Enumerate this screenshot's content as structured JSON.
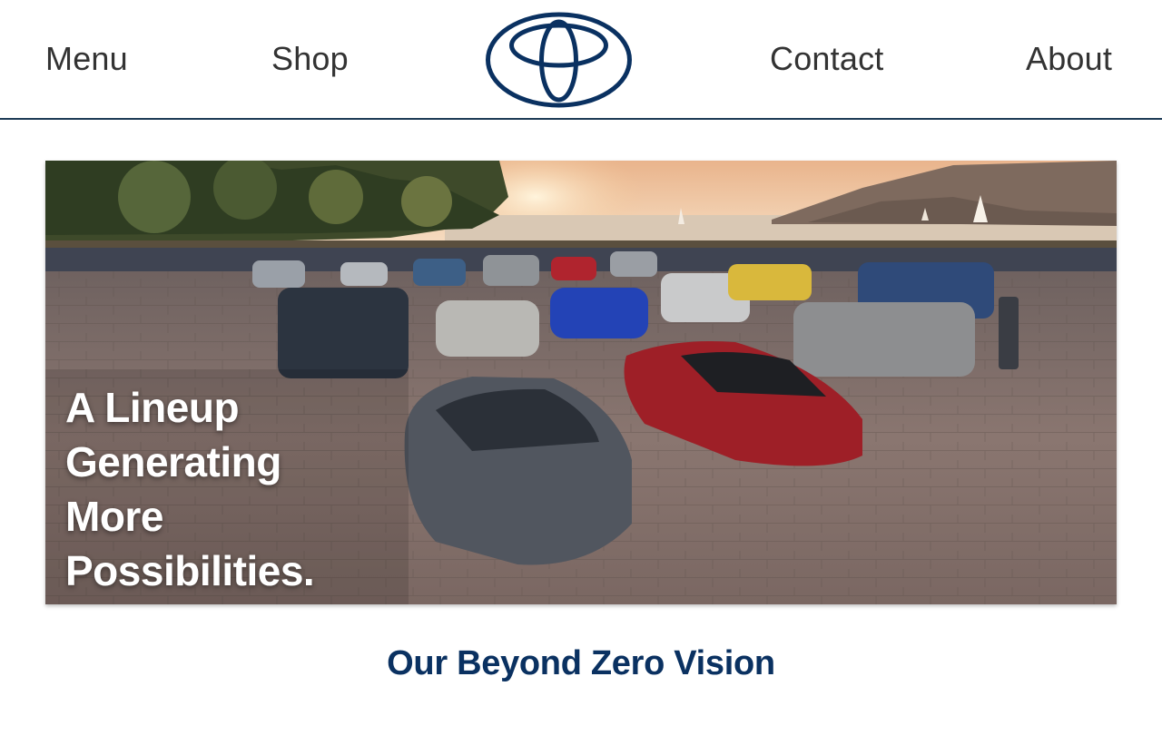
{
  "nav": {
    "menu_label": "Menu",
    "shop_label": "Shop",
    "contact_label": "Contact",
    "about_label": "About"
  },
  "logo": {
    "icon": "toyota-logo-icon",
    "color": "#0a3161"
  },
  "hero": {
    "title": "A Lineup Generating More Possibilities."
  },
  "section": {
    "title": "Our Beyond Zero Vision"
  },
  "colors": {
    "brand_navy": "#0a3161",
    "nav_text": "#333333",
    "divider": "#1c3a55"
  }
}
